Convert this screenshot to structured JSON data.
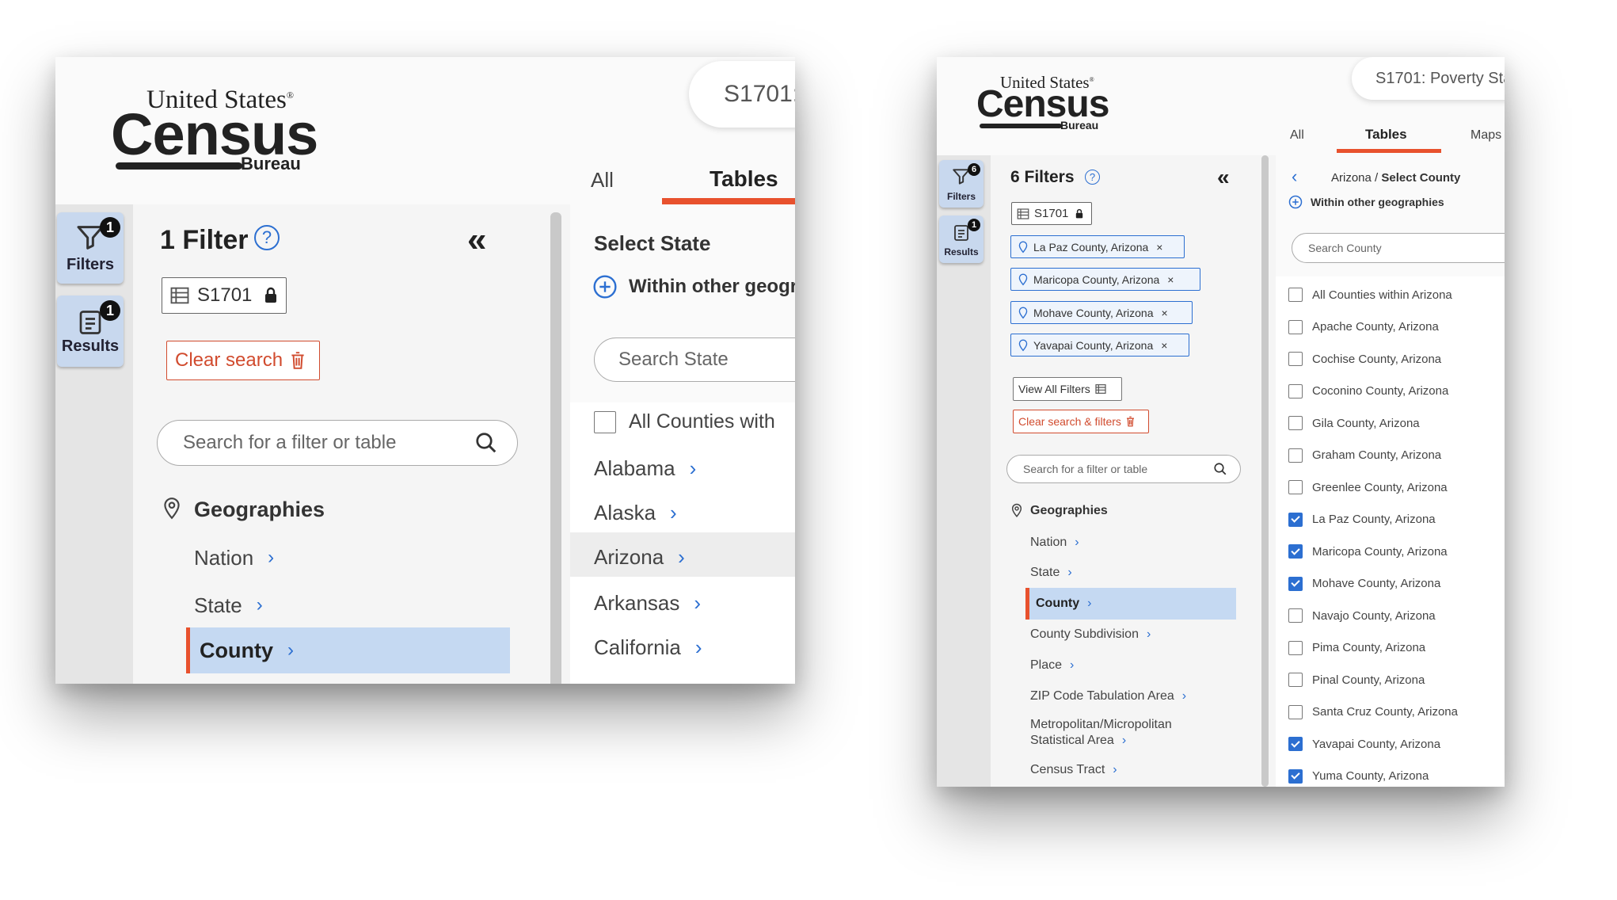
{
  "logo": {
    "united_states": "United States",
    "reg": "®",
    "census": "Census",
    "bureau": "Bureau"
  },
  "left": {
    "search_top": "S1701:",
    "tabs": {
      "all": "All",
      "tables": "Tables"
    },
    "rail": {
      "filters_label": "Filters",
      "filters_badge": "1",
      "results_label": "Results",
      "results_badge": "1"
    },
    "filter_title": "1 Filter",
    "chip_label": "S1701",
    "clear_search": "Clear search",
    "search_placeholder": "Search for a filter or table",
    "geographies": "Geographies",
    "nav": {
      "nation": "Nation",
      "state": "State",
      "county": "County"
    },
    "select_state": "Select State",
    "within_other": "Within other geogra",
    "search_state": "Search State",
    "all_counties": "All Counties with",
    "states": [
      "Alabama",
      "Alaska",
      "Arizona",
      "Arkansas",
      "California"
    ]
  },
  "right": {
    "search_top": "S1701: Poverty Sta",
    "tabs": {
      "all": "All",
      "tables": "Tables",
      "maps": "Maps"
    },
    "rail": {
      "filters_label": "Filters",
      "filters_badge": "6",
      "results_label": "Results",
      "results_badge": "1"
    },
    "filter_title": "6 Filters",
    "chip_label": "S1701",
    "geo_chips": [
      "La Paz County, Arizona",
      "Maricopa County, Arizona",
      "Mohave County, Arizona",
      "Yavapai County, Arizona"
    ],
    "view_all": "View All Filters",
    "clear_search": "Clear search & filters",
    "search_placeholder": "Search for a filter or table",
    "geographies": "Geographies",
    "nav": {
      "nation": "Nation",
      "state": "State",
      "county": "County",
      "county_sub": "County Subdivision",
      "place": "Place",
      "zip": "ZIP Code Tabulation Area",
      "metro_1": "Metropolitan/Micropolitan",
      "metro_2": "Statistical Area",
      "tract": "Census Tract"
    },
    "breadcrumb_state": "Arizona",
    "breadcrumb_sep": "/",
    "breadcrumb_current": "Select County",
    "within_other": "Within other geographies",
    "search_county": "Search County",
    "counties": [
      {
        "label": "All Counties within Arizona",
        "checked": false
      },
      {
        "label": "Apache County, Arizona",
        "checked": false
      },
      {
        "label": "Cochise County, Arizona",
        "checked": false
      },
      {
        "label": "Coconino County, Arizona",
        "checked": false
      },
      {
        "label": "Gila County, Arizona",
        "checked": false
      },
      {
        "label": "Graham County, Arizona",
        "checked": false
      },
      {
        "label": "Greenlee County, Arizona",
        "checked": false
      },
      {
        "label": "La Paz County, Arizona",
        "checked": true
      },
      {
        "label": "Maricopa County, Arizona",
        "checked": true
      },
      {
        "label": "Mohave County, Arizona",
        "checked": true
      },
      {
        "label": "Navajo County, Arizona",
        "checked": false
      },
      {
        "label": "Pima County, Arizona",
        "checked": false
      },
      {
        "label": "Pinal County, Arizona",
        "checked": false
      },
      {
        "label": "Santa Cruz County, Arizona",
        "checked": false
      },
      {
        "label": "Yavapai County, Arizona",
        "checked": true
      },
      {
        "label": "Yuma County, Arizona",
        "checked": true
      }
    ]
  },
  "colors": {
    "accent": "#e8512d",
    "blue": "#2c6fd1",
    "selected_bg": "#c5d9f2",
    "rail_btn": "#c8d8ee"
  }
}
